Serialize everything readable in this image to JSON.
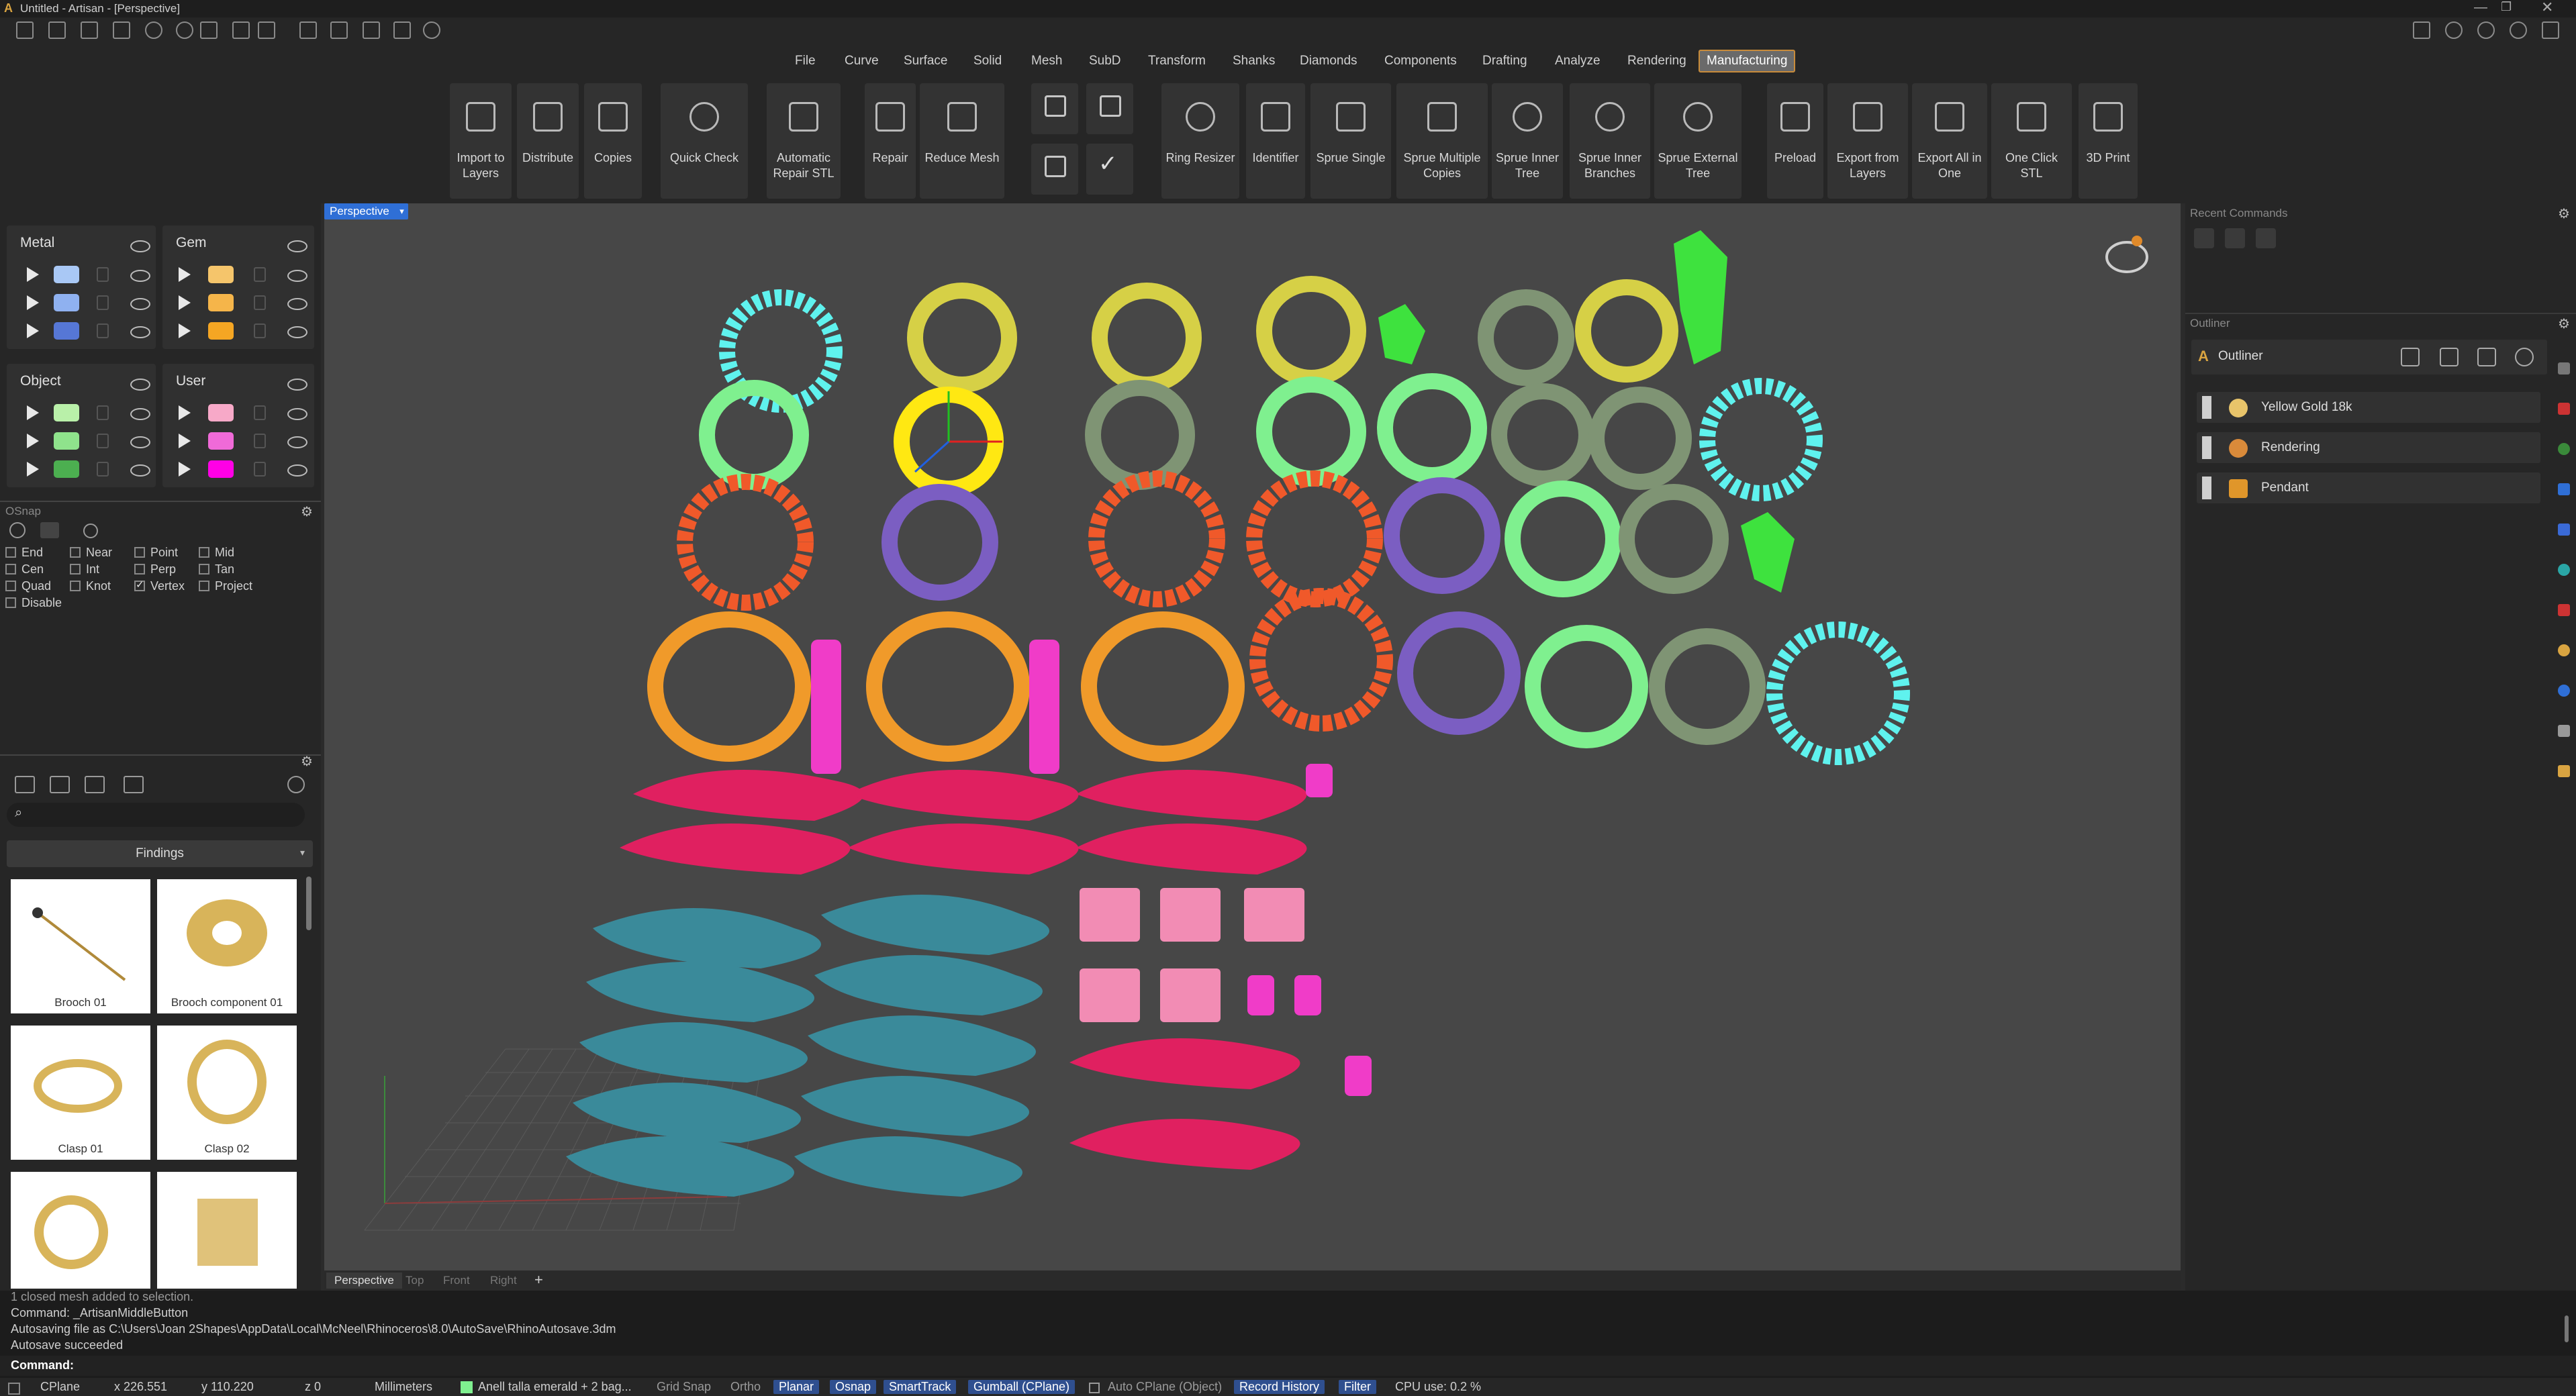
{
  "window": {
    "title": "Untitled - Artisan - [Perspective]"
  },
  "menu": [
    "File",
    "Curve",
    "Surface",
    "Solid",
    "Mesh",
    "SubD",
    "Transform",
    "Shanks",
    "Diamonds",
    "Components",
    "Drafting",
    "Analyze",
    "Rendering",
    "Manufacturing"
  ],
  "menu_active": "Manufacturing",
  "ribbon": {
    "import_to_layers": "Import to Layers",
    "distribute": "Distribute",
    "copies": "Copies",
    "quick_check": "Quick Check",
    "automatic_repair_stl": "Automatic Repair STL",
    "repair": "Repair",
    "reduce_mesh": "Reduce Mesh",
    "ring_resizer": "Ring Resizer",
    "identifier": "Identifier",
    "sprue_single": "Sprue Single",
    "sprue_multiple_copies": "Sprue Multiple Copies",
    "sprue_inner_tree": "Sprue Inner Tree",
    "sprue_inner_branches": "Sprue Inner Branches",
    "sprue_external_tree": "Sprue External Tree",
    "preload": "Preload",
    "export_from_layers": "Export from Layers",
    "export_all_in_one": "Export All in One",
    "one_click_stl": "One Click STL",
    "print_3d": "3D Print"
  },
  "layers": {
    "metal": {
      "title": "Metal",
      "colors": [
        "#a9c8f5",
        "#8fb1f0",
        "#5677d6"
      ]
    },
    "gem": {
      "title": "Gem",
      "colors": [
        "#f5c56b",
        "#f5b54a",
        "#f5a623"
      ]
    },
    "object": {
      "title": "Object",
      "colors": [
        "#b9f0a9",
        "#8fe38c",
        "#4caf50"
      ]
    },
    "user": {
      "title": "User",
      "colors": [
        "#f7a9c8",
        "#f06ad8",
        "#ff00e6"
      ]
    }
  },
  "osnap": {
    "title": "OSnap",
    "items": [
      {
        "label": "End",
        "checked": false
      },
      {
        "label": "Near",
        "checked": false
      },
      {
        "label": "Point",
        "checked": false
      },
      {
        "label": "Mid",
        "checked": false
      },
      {
        "label": "Cen",
        "checked": false
      },
      {
        "label": "Int",
        "checked": false
      },
      {
        "label": "Perp",
        "checked": false
      },
      {
        "label": "Tan",
        "checked": false
      },
      {
        "label": "Quad",
        "checked": false
      },
      {
        "label": "Knot",
        "checked": false
      },
      {
        "label": "Vertex",
        "checked": true
      },
      {
        "label": "Project",
        "checked": false
      },
      {
        "label": "Disable",
        "checked": false
      }
    ]
  },
  "library": {
    "dropdown": "Findings",
    "items": [
      "Brooch 01",
      "Brooch component 01",
      "Clasp 01",
      "Clasp 02"
    ]
  },
  "viewport": {
    "active_tab": "Perspective",
    "tabs": [
      "Perspective",
      "Top",
      "Front",
      "Right"
    ]
  },
  "right": {
    "recent_commands": "Recent Commands",
    "outliner_header": "Outliner",
    "outliner_title": "Outliner",
    "items": [
      "Yellow Gold 18k",
      "Rendering",
      "Pendant"
    ]
  },
  "command": {
    "history": [
      "1 closed mesh added to selection.",
      "Command: _ArtisanMiddleButton",
      "Autosaving file as C:\\Users\\Joan 2Shapes\\AppData\\Local\\McNeel\\Rhinoceros\\8.0\\AutoSave\\RhinoAutosave.3dm",
      "Autosave succeeded"
    ],
    "prompt": "Command:"
  },
  "status": {
    "cplane": "CPlane",
    "x": "x 226.551",
    "y": "y 110.220",
    "z": "z 0",
    "units": "Millimeters",
    "layer": "Anell talla emerald + 2 bag...",
    "grid_snap": "Grid Snap",
    "ortho": "Ortho",
    "planar": "Planar",
    "osnap": "Osnap",
    "smarttrack": "SmartTrack",
    "gumball": "Gumball (CPlane)",
    "auto_cplane": "Auto CPlane (Object)",
    "record_history": "Record History",
    "filter": "Filter",
    "cpu": "CPU use: 0.2 %"
  },
  "colors": {
    "accent": "#2f6fd6",
    "active_tab_border": "#c88b3a"
  }
}
